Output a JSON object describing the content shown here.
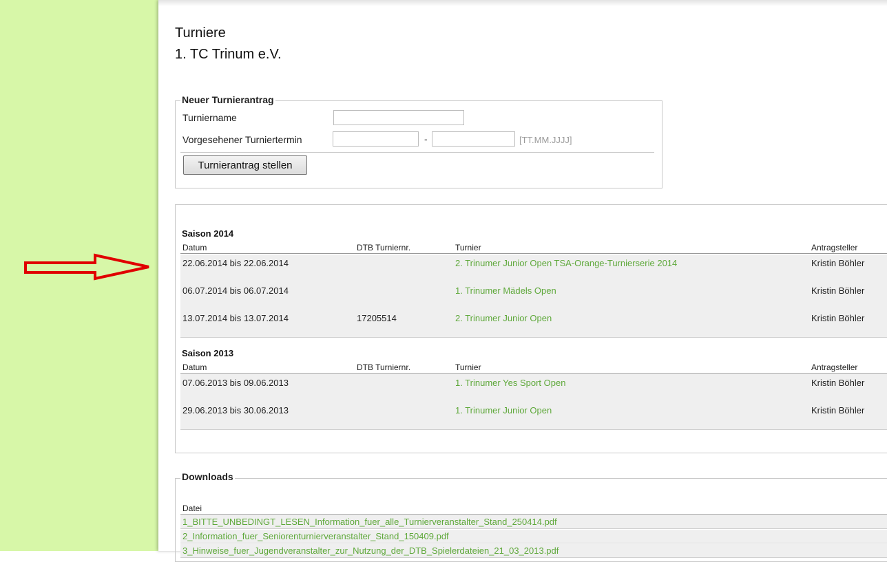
{
  "header": {
    "title": "Turniere",
    "club": "1. TC Trinum e.V."
  },
  "new_request": {
    "legend": "Neuer Turnierantrag",
    "name_label": "Turniername",
    "name_value": "",
    "date_label": "Vorgesehener Turniertermin",
    "date_from_value": "",
    "date_to_value": "",
    "date_separator": "-",
    "date_hint": "[TT.MM.JJJJ]",
    "submit_label": "Turnierantrag stellen"
  },
  "columns": {
    "date": "Datum",
    "dtb": "DTB Turniernr.",
    "tournament": "Turnier",
    "applicant": "Antragsteller"
  },
  "seasons": [
    {
      "title": "Saison 2014",
      "rows": [
        {
          "date": "22.06.2014 bis 22.06.2014",
          "dtb": "",
          "tournament": "2. Trinumer Junior Open TSA-Orange-Turnierserie 2014",
          "applicant": "Kristin Böhler"
        },
        {
          "date": "06.07.2014 bis 06.07.2014",
          "dtb": "",
          "tournament": "1. Trinumer Mädels Open",
          "applicant": "Kristin Böhler"
        },
        {
          "date": "13.07.2014 bis 13.07.2014",
          "dtb": "17205514",
          "tournament": "2. Trinumer Junior Open",
          "applicant": "Kristin Böhler"
        }
      ]
    },
    {
      "title": "Saison 2013",
      "rows": [
        {
          "date": "07.06.2013 bis 09.06.2013",
          "dtb": "",
          "tournament": "1. Trinumer Yes Sport Open",
          "applicant": "Kristin Böhler"
        },
        {
          "date": "29.06.2013 bis 30.06.2013",
          "dtb": "",
          "tournament": "1. Trinumer Junior Open",
          "applicant": "Kristin Böhler"
        }
      ]
    }
  ],
  "downloads": {
    "legend": "Downloads",
    "column": "Datei",
    "files": [
      "1_BITTE_UNBEDINGT_LESEN_Information_fuer_alle_Turnierveranstalter_Stand_250414.pdf",
      "2_Information_fuer_Seniorenturnierveranstalter_Stand_150409.pdf",
      "3_Hinweise_fuer_Jugendveranstalter_zur_Nutzung_der_DTB_Spielerdateien_21_03_2013.pdf"
    ]
  },
  "colors": {
    "sidebar": "#d7f7a8",
    "link": "#5ea83a",
    "arrow": "#e00000",
    "row_bg": "#efefef"
  },
  "icons": {
    "annotation_arrow": "right-arrow-icon"
  }
}
